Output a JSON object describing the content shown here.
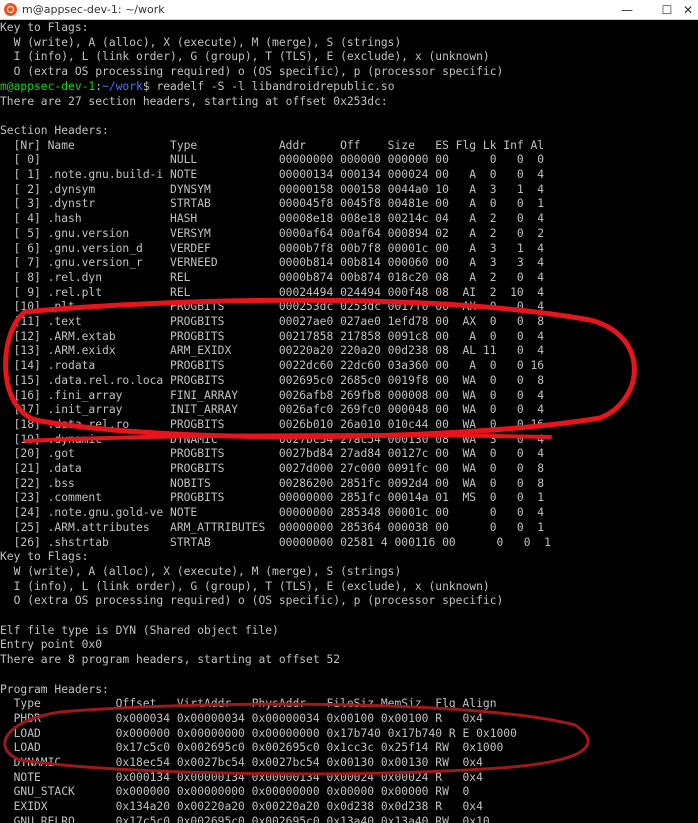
{
  "window": {
    "title": "m@appsec-dev-1: ~/work",
    "minimize_glyph": "—",
    "maximize_glyph": "☐",
    "close_glyph": "✕"
  },
  "terminal": {
    "before_prompt": [
      "Key to Flags:",
      "  W (write), A (alloc), X (execute), M (merge), S (strings)",
      "  I (info), L (link order), G (group), T (TLS), E (exclude), x (unknown)",
      "  O (extra OS processing required) o (OS specific), p (processor specific)"
    ],
    "prompt": {
      "user": "m@appsec-dev-1",
      "sep": ":",
      "path": "~/work",
      "command": "$ readelf -S -l libandroidrepublic.so"
    },
    "after_prompt": [
      "There are 27 section headers, starting at offset 0x253dc:",
      "",
      "Section Headers:",
      "  [Nr] Name              Type            Addr     Off    Size   ES Flg Lk Inf Al",
      "  [ 0]                   NULL            00000000 000000 000000 00      0   0  0",
      "  [ 1] .note.gnu.build-i NOTE            00000134 000134 000024 00   A  0   0  4",
      "  [ 2] .dynsym           DYNSYM          00000158 000158 0044a0 10   A  3   1  4",
      "  [ 3] .dynstr           STRTAB          000045f8 0045f8 00481e 00   A  0   0  1",
      "  [ 4] .hash             HASH            00008e18 008e18 00214c 04   A  2   0  4",
      "  [ 5] .gnu.version      VERSYM          0000af64 00af64 000894 02   A  2   0  2",
      "  [ 6] .gnu.version_d    VERDEF          0000b7f8 00b7f8 00001c 00   A  3   1  4",
      "  [ 7] .gnu.version_r    VERNEED         0000b814 00b814 000060 00   A  3   3  4",
      "  [ 8] .rel.dyn          REL             0000b874 00b874 018c20 08   A  2   0  4",
      "  [ 9] .rel.plt          REL             00024494 024494 000f48 08  AI  2  10  4",
      "  [10] .plt              PROGBITS        000253dc 0253dc 0017f0 00  AX  0   0  4",
      "  [11] .text             PROGBITS        00027ae0 027ae0 1efd78 00  AX  0   0  8",
      "  [12] .ARM.extab        PROGBITS        00217858 217858 0091c8 00   A  0   0  4",
      "  [13] .ARM.exidx        ARM_EXIDX       00220a20 220a20 00d238 08  AL 11   0  4",
      "  [14] .rodata           PROGBITS        0022dc60 22dc60 03a360 00   A  0   0 16",
      "  [15] .data.rel.ro.loca PROGBITS        002695c0 2685c0 0019f8 00  WA  0   0  8",
      "  [16] .fini_array       FINI_ARRAY      0026afb8 269fb8 000008 00  WA  0   0  4",
      "  [17] .init_array       INIT_ARRAY      0026afc0 269fc0 000048 00  WA  0   0  4",
      "  [18] .data.rel.ro      PROGBITS        0026b010 26a010 010c44 00  WA  0   0 16",
      "  [19] .dynamic          DYNAMIC         0027bc54 27ac54 000130 08  WA  3   0  4",
      "  [20] .got              PROGBITS        0027bd84 27ad84 00127c 00  WA  0   0  4",
      "  [21] .data             PROGBITS        0027d000 27c000 0091fc 00  WA  0   0  8",
      "  [22] .bss              NOBITS          00286200 2851fc 0092d4 00  WA  0   0  8",
      "  [23] .comment          PROGBITS        00000000 2851fc 00014a 01  MS  0   0  1",
      "  [24] .note.gnu.gold-ve NOTE            00000000 285348 00001c 00      0   0  4",
      "  [25] .ARM.attributes   ARM_ATTRIBUTES  00000000 285364 000038 00      0   0  1",
      "  [26] .shstrtab         STRTAB          00000000 02581 4 000116 00      0   0  1",
      "Key to Flags:",
      "  W (write), A (alloc), X (execute), M (merge), S (strings)",
      "  I (info), L (link order), G (group), T (TLS), E (exclude), x (unknown)",
      "  O (extra OS processing required) o (OS specific), p (processor specific)",
      "",
      "Elf file type is DYN (Shared object file)",
      "Entry point 0x0",
      "There are 8 program headers, starting at offset 52",
      "",
      "Program Headers:",
      "  Type           Offset   VirtAddr   PhysAddr   FileSiz MemSiz  Flg Align",
      "  PHDR           0x000034 0x00000034 0x00000034 0x00100 0x00100 R   0x4",
      "  LOAD           0x000000 0x00000000 0x00000000 0x17b740 0x17b740 R E 0x1000",
      "  LOAD           0x17c5c0 0x002695c0 0x002695c0 0x1cc3c 0x25f14 RW  0x1000",
      "  DYNAMIC        0x18ec54 0x0027bc54 0x0027bc54 0x00130 0x00130 RW  0x4",
      "  NOTE           0x000134 0x00000134 0x00000134 0x00024 0x00024 R   0x4",
      "  GNU_STACK      0x000000 0x00000000 0x00000000 0x00000 0x00000 RW  0",
      "  EXIDX          0x134a20 0x00220a20 0x00220a20 0x0d238 0x0d238 R   0x4",
      "  GNU_RELRO      0x17c5c0 0x002695c0 0x002695c0 0x13a40 0x13a40 RW  0x10"
    ],
    "highlighted_lines": [
      50,
      51
    ],
    "colors": {
      "background": "#000000",
      "text": "#c0c0c0",
      "prompt_user": "#13d80d",
      "prompt_path": "#3b78ff",
      "highlight_text": "#f0f000",
      "annotation_red": "#e8141c",
      "annotation_darkred": "#a01818"
    }
  }
}
